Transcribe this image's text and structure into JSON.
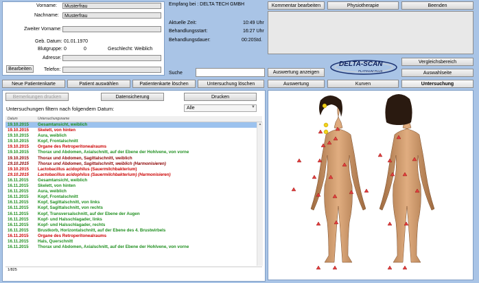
{
  "patient": {
    "vorname_label": "Vorname:",
    "vorname": "Musterfrau",
    "nachname_label": "Nachname:",
    "nachname": "Musterfrau",
    "zweiter_label": "Zweiter Vorname:",
    "zweiter": "",
    "geb_label": "Geb. Datum:",
    "geb": "01.01.1970",
    "blut_label": "Blutgruppe:",
    "blut_a": "0",
    "blut_b": "0",
    "geschlecht_label": "Geschlecht:",
    "geschlecht": "Weiblich",
    "adresse_label": "Adresse:",
    "adresse": "",
    "telefon_label": "Telefon:",
    "telefon": "",
    "edit_button": "Bearbeiten"
  },
  "session": {
    "empfang": "Empfang bei : DELTA TECH GMBH",
    "zeit_label": "Aktuelle Zeit:",
    "zeit": "10:49 Uhr",
    "start_label": "Behandlungsstart:",
    "start": "16:27 Uhr",
    "dauer_label": "Behandlungsdauer:",
    "dauer": "00:20Std."
  },
  "top_buttons": {
    "kommentar": "Kommentar bearbeiten",
    "physio": "Physiotherapie",
    "beenden": "Beenden"
  },
  "logo": {
    "name": "DELTA-SCAN",
    "sub": "PLATINUM PLUS"
  },
  "right_buttons": {
    "vergleich": "Vergleichsbereich",
    "auswahl": "Auswahlseite"
  },
  "search": {
    "label": "Suche",
    "value": "",
    "show_button": "Auswertung anzeigen"
  },
  "nav": [
    "Neue Patientenkarte",
    "Patient auswählen",
    "Patientenkarte löschen",
    "Untersuchung löschen",
    "Auswertung",
    "Kurven",
    "Untersuchung"
  ],
  "list_toolbar": {
    "bemerkungen": "Bemerkungen drucken",
    "sicherung": "Datensicherung",
    "drucken": "Drucken"
  },
  "filter": {
    "label": "Untersuchungen filtern nach folgendem Datum:",
    "value": "Alle"
  },
  "table": {
    "col_date": "Datum",
    "col_name": "Untersuchungsname",
    "rows": [
      {
        "d": "19.10.2015",
        "n": "Gesamtansicht, weiblich",
        "c": "#1f8f1f",
        "i": false
      },
      {
        "d": "19.10.2015",
        "n": "Skelett, von hinten",
        "c": "#cc0000",
        "i": false
      },
      {
        "d": "19.10.2015",
        "n": "Aura, weiblich",
        "c": "#1f8f1f",
        "i": false
      },
      {
        "d": "19.10.2015",
        "n": "Kopf, Frontalschnitt",
        "c": "#1f8f1f",
        "i": false
      },
      {
        "d": "19.10.2015",
        "n": "Organe des Retroperitonealraums",
        "c": "#cc0000",
        "i": false
      },
      {
        "d": "19.10.2015",
        "n": "Thorax und Abdomen, Axialschnitt, auf der Ebene der Hohlvene, von vorne",
        "c": "#1f8f1f",
        "i": false
      },
      {
        "d": "19.10.2015",
        "n": "Thorax und Abdomen, Sagittalschnitt, weiblich",
        "c": "#8b0000",
        "i": false
      },
      {
        "d": "19.10.2015",
        "n": "Thorax und Abdomen, Sagittalschnitt, weiblich (Harmonisieren)",
        "c": "#8b0000",
        "i": true
      },
      {
        "d": "19.10.2015",
        "n": "Lactobacillus acidophilus (Sauermilchbakterium)",
        "c": "#cc0000",
        "i": false
      },
      {
        "d": "19.10.2015",
        "n": "Lactobacillus acidophilus (Sauermilchbakterium) (Harmonisieren)",
        "c": "#cc0000",
        "i": true
      },
      {
        "d": "16.11.2015",
        "n": "Gesamtansicht, weiblich",
        "c": "#1f8f1f",
        "i": false
      },
      {
        "d": "16.11.2015",
        "n": "Skelett, von hinten",
        "c": "#1f8f1f",
        "i": false
      },
      {
        "d": "16.11.2015",
        "n": "Aura, weiblich",
        "c": "#1f8f1f",
        "i": false
      },
      {
        "d": "16.11.2015",
        "n": "Kopf, Frontalschnitt",
        "c": "#1f8f1f",
        "i": false
      },
      {
        "d": "16.11.2015",
        "n": "Kopf, Sagittalschnitt, von links",
        "c": "#1f8f1f",
        "i": false
      },
      {
        "d": "16.11.2015",
        "n": "Kopf, Sagittalschnitt, von rechts",
        "c": "#1f8f1f",
        "i": false
      },
      {
        "d": "16.11.2015",
        "n": "Kopf, Transversalschnitt, auf der Ebene der Augen",
        "c": "#1f8f1f",
        "i": false
      },
      {
        "d": "16.11.2015",
        "n": "Kopf- und Halsschlagader, links",
        "c": "#1f8f1f",
        "i": false
      },
      {
        "d": "16.11.2015",
        "n": "Kopf- und Halsschlagader, rechts",
        "c": "#1f8f1f",
        "i": false
      },
      {
        "d": "16.11.2015",
        "n": "Brustkorb, Horizontalschnitt, auf der Ebene des 4. Brustwirbels",
        "c": "#1f8f1f",
        "i": false
      },
      {
        "d": "16.11.2015",
        "n": "Organe des Retroperitonealraums",
        "c": "#cc0000",
        "i": false
      },
      {
        "d": "16.11.2015",
        "n": "Hals, Querschnitt",
        "c": "#1f8f1f",
        "i": false
      },
      {
        "d": "16.11.2015",
        "n": "Thorax und Abdomen, Axialschnitt, auf der Ebene der Hohlvene, von vorne",
        "c": "#1f8f1f",
        "i": false
      }
    ],
    "footer": "1/825"
  },
  "colors": {
    "background": "#a9c4e6",
    "healthy": "#1f8f1f",
    "problem": "#cc0000",
    "selected": "#9cc2ee"
  }
}
